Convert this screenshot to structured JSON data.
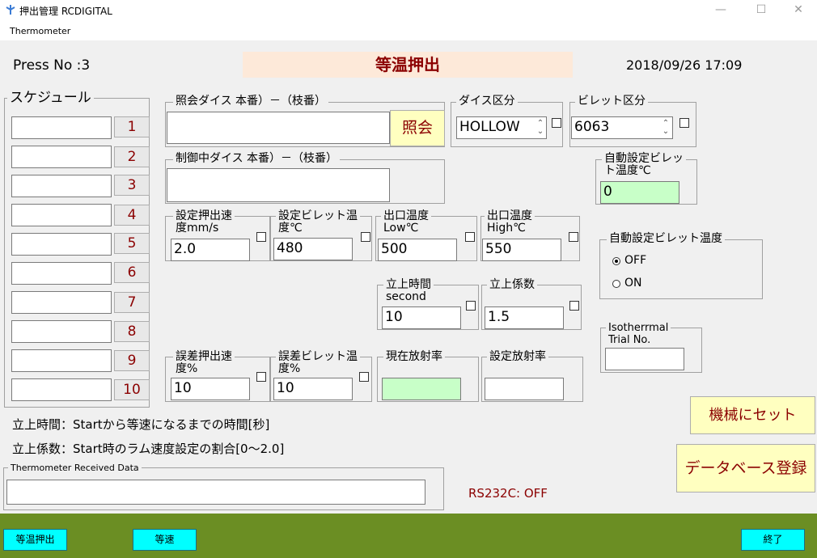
{
  "window": {
    "title": "押出管理 RCDIGITAL",
    "controls": {
      "min": "—",
      "max": "☐",
      "close": "✕"
    }
  },
  "menu": {
    "thermometer": "Thermometer"
  },
  "header": {
    "press_no": "Press No :3",
    "banner": "等温押出",
    "datetime": "2018/09/26  17:09"
  },
  "schedule": {
    "legend": "スケジュール",
    "rows": [
      {
        "num": "1",
        "value": ""
      },
      {
        "num": "2",
        "value": ""
      },
      {
        "num": "3",
        "value": ""
      },
      {
        "num": "4",
        "value": ""
      },
      {
        "num": "5",
        "value": ""
      },
      {
        "num": "6",
        "value": ""
      },
      {
        "num": "7",
        "value": ""
      },
      {
        "num": "8",
        "value": ""
      },
      {
        "num": "9",
        "value": ""
      },
      {
        "num": "10",
        "value": ""
      }
    ]
  },
  "query_die": {
    "legend": "照会ダイス 本番）－（枝番）",
    "value": "",
    "button": "照会"
  },
  "die_type": {
    "legend": "ダイス区分",
    "value": "HOLLOW"
  },
  "billet_type": {
    "legend": "ビレット区分",
    "value": "6063"
  },
  "controlling_die": {
    "legend": "制御中ダイス 本番）－（枝番）",
    "value": ""
  },
  "auto_billet_temp": {
    "legend_l1": "自動設定ビレッ",
    "legend_l2": "ト温度℃",
    "value": "0"
  },
  "set_speed": {
    "legend_l1": "設定押出速",
    "legend_l2": "度mm/s",
    "value": "2.0"
  },
  "set_billet_temp": {
    "legend_l1": "設定ビレット温",
    "legend_l2": "度℃",
    "value": "480"
  },
  "exit_temp_low": {
    "legend_l1": "出口温度",
    "legend_l2": "Low℃",
    "value": "500"
  },
  "exit_temp_high": {
    "legend_l1": "出口温度",
    "legend_l2": "High℃",
    "value": "550"
  },
  "auto_billet_toggle": {
    "legend": "自動設定ビレット温度",
    "off": "OFF",
    "on": "ON"
  },
  "rise_time": {
    "legend_l1": "立上時間",
    "legend_l2": "second",
    "value": "10"
  },
  "rise_coef": {
    "legend": "立上係数",
    "value": "1.5"
  },
  "isothermal": {
    "legend_l1": "Isotherrmal",
    "legend_l2": "Trial No.",
    "value": ""
  },
  "err_speed": {
    "legend_l1": "誤差押出速",
    "legend_l2": "度%",
    "value": "10"
  },
  "err_billet": {
    "legend_l1": "誤差ビレット温",
    "legend_l2": "度%",
    "value": "10"
  },
  "current_emissivity": {
    "legend": "現在放射率",
    "value": ""
  },
  "set_emissivity": {
    "legend": "設定放射率",
    "value": ""
  },
  "info": {
    "line1": "立上時間：Startから等速になるまでの時間[秒]",
    "line2": "立上係数：Start時のラム速度設定の割合[0～2.0]"
  },
  "thermo_data": {
    "legend": "Thermometer Received Data",
    "value": ""
  },
  "rs232c": "RS232C: OFF",
  "buttons": {
    "set_machine": "機械にセット",
    "db_register": "データベース登録",
    "isothermal": "等温押出",
    "constant": "等速",
    "exit": "終了"
  },
  "colors": {
    "dark_red": "#8b0000",
    "footer_green": "#6b8e23",
    "cyan": "#00ffff",
    "light_yellow": "#ffffc0",
    "light_green": "#c8ffc8",
    "banner_bg": "#fde9d9"
  }
}
